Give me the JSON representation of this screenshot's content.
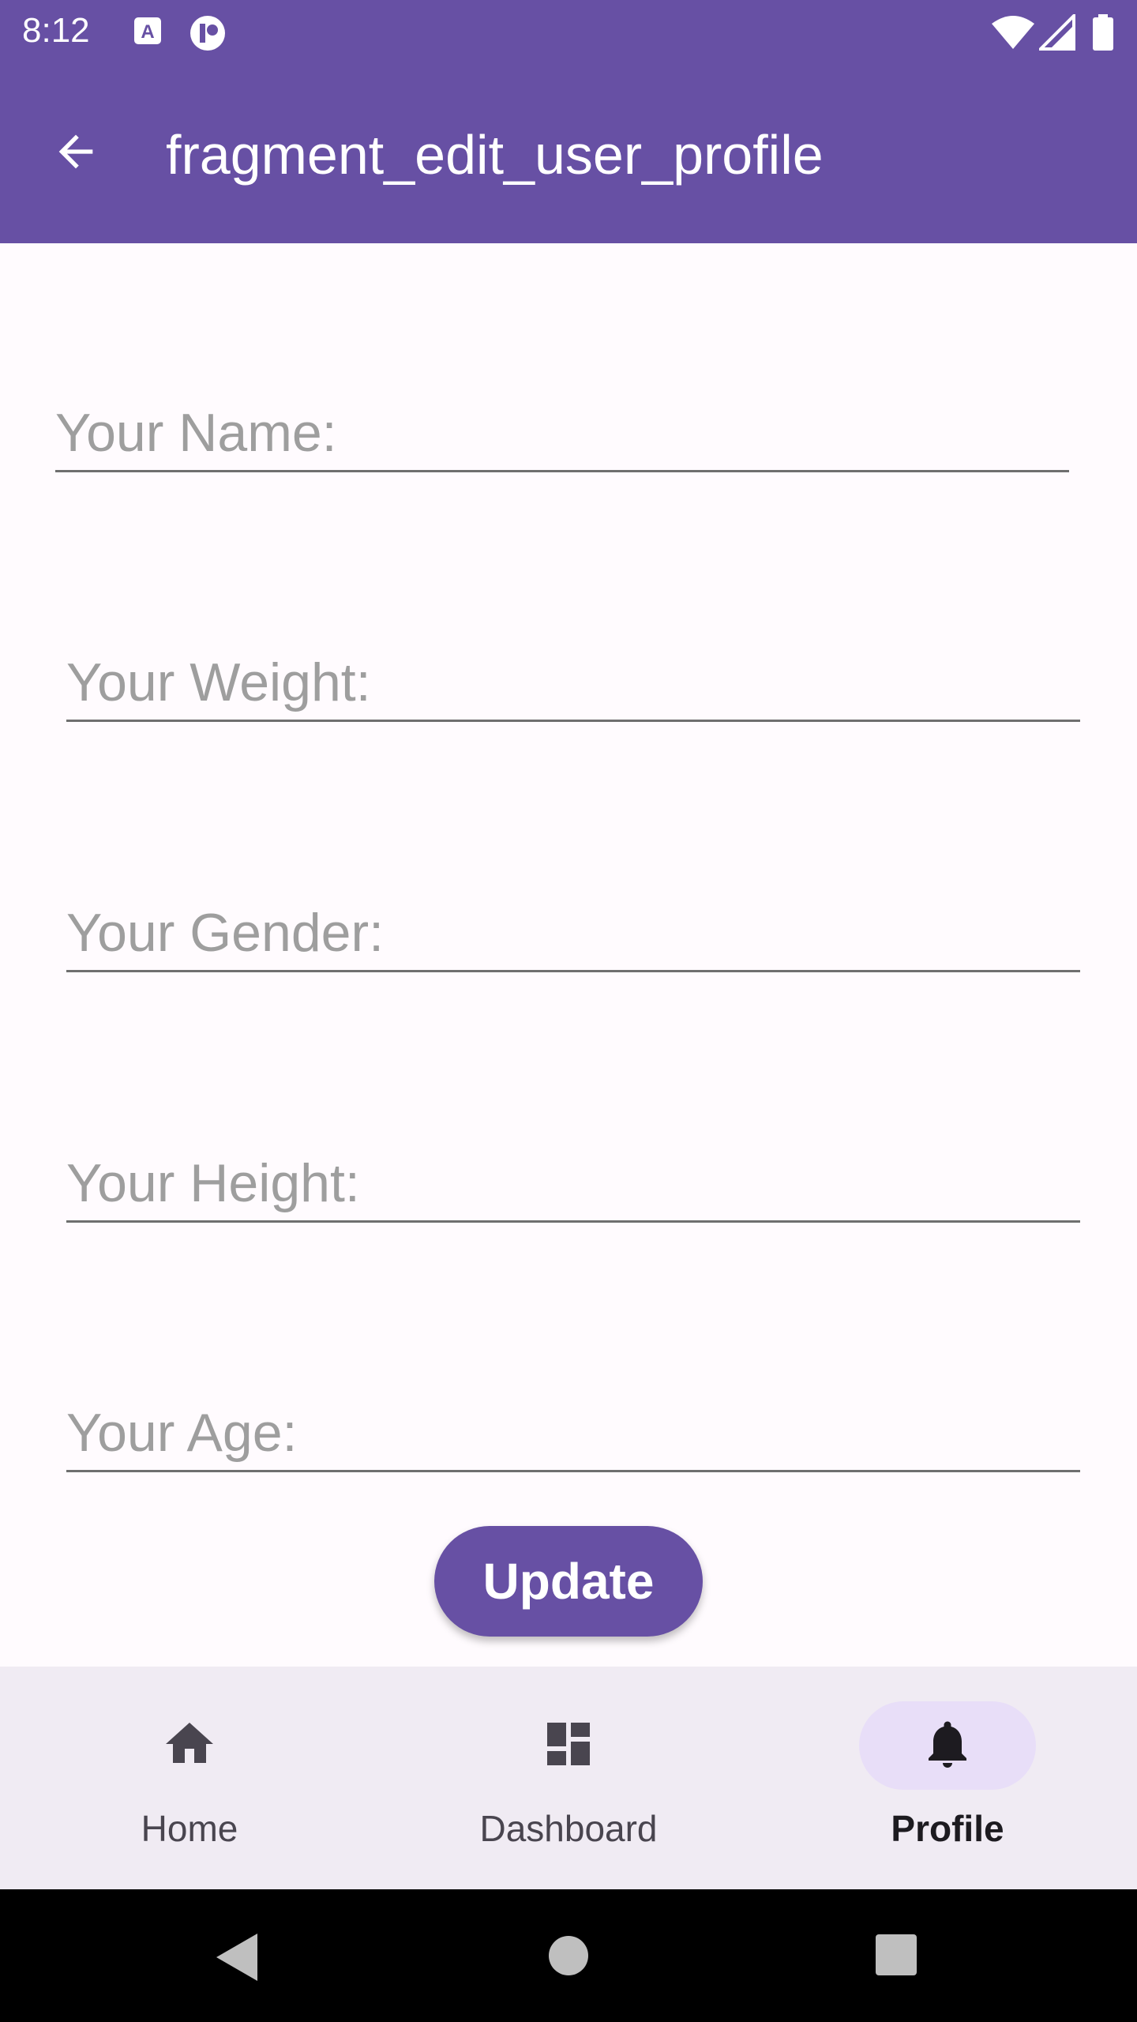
{
  "status_bar": {
    "time": "8:12"
  },
  "app_bar": {
    "title": "fragment_edit_user_profile"
  },
  "form": {
    "name_placeholder": "Your Name:",
    "weight_placeholder": "Your Weight:",
    "gender_placeholder": "Your Gender:",
    "height_placeholder": "Your Height:",
    "age_placeholder": "Your Age:",
    "update_label": "Update"
  },
  "bottom_nav": {
    "items": [
      {
        "label": "Home",
        "icon": "home-icon"
      },
      {
        "label": "Dashboard",
        "icon": "dashboard-icon"
      },
      {
        "label": "Profile",
        "icon": "bell-icon",
        "active": true
      }
    ]
  },
  "colors": {
    "primary": "#6750a4",
    "nav_bg": "#f0ebf3",
    "active_pill": "#e8def8"
  }
}
